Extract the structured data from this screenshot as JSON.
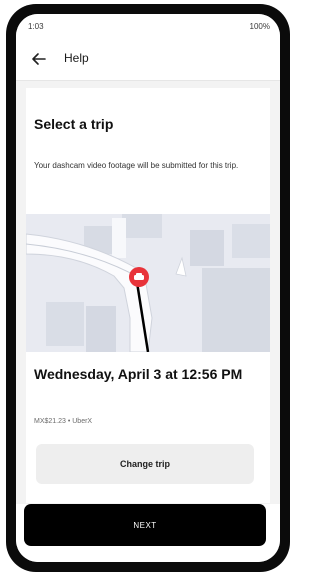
{
  "status_bar": {
    "time": "1:03",
    "indicators": "100%"
  },
  "header": {
    "title": "Help",
    "back_icon": "arrow-left-icon"
  },
  "content": {
    "title": "Select a trip",
    "description": "Your dashcam video footage will be submitted for this trip.",
    "map": {
      "pin_icon": "car-location-pin-icon",
      "pin_color": "#e8333a"
    },
    "trip": {
      "datetime": "Wednesday, April 3 at 12:56 PM",
      "details": "MX$21.23 • UberX",
      "change_label": "Change trip"
    }
  },
  "footer": {
    "next_label": "NEXT"
  }
}
